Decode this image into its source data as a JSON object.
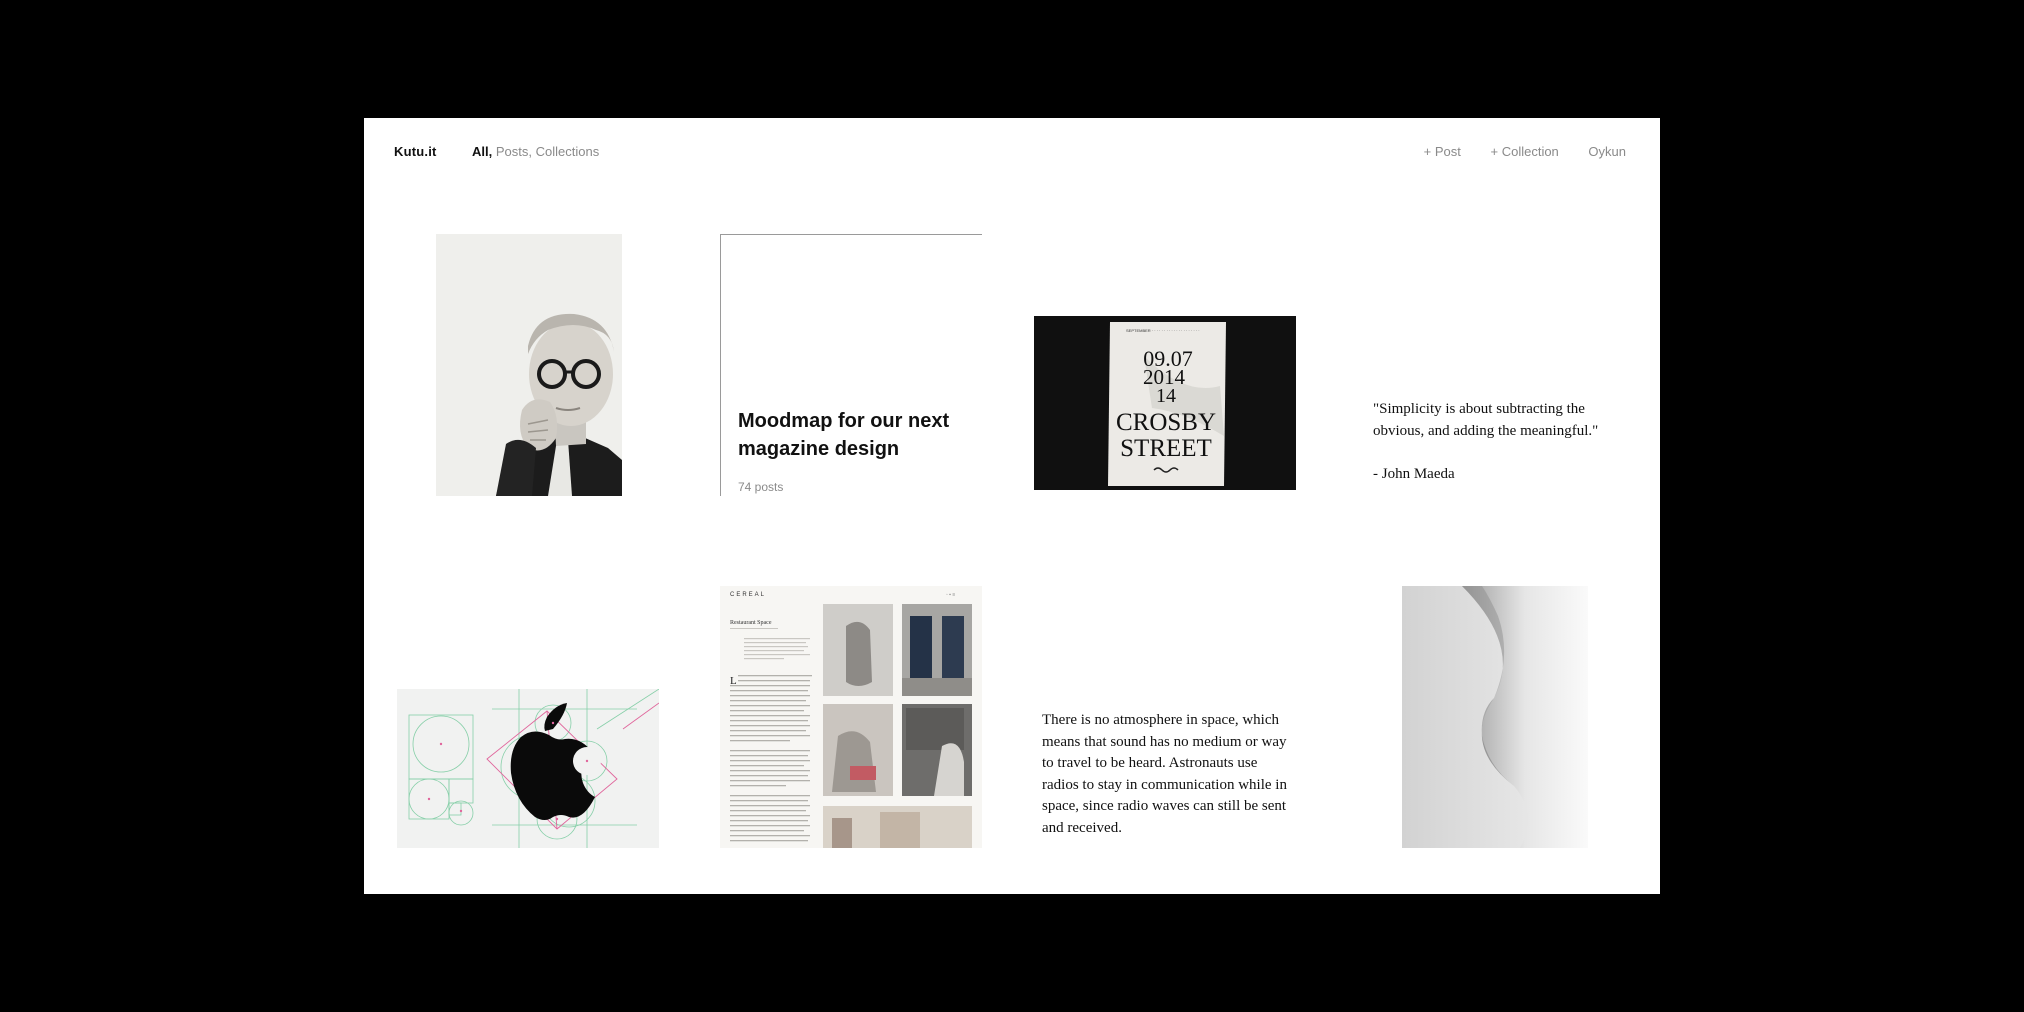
{
  "nav": {
    "brand": "Kutu.it",
    "filters": {
      "all": "All,",
      "posts": "Posts,",
      "collections": "Collections"
    },
    "actions": {
      "add_post": "+ Post",
      "add_collection": "+ Collection",
      "user": "Oykun"
    }
  },
  "cards": {
    "collection": {
      "title": "Moodmap for our next magazine design",
      "count": "74 posts"
    },
    "poster": {
      "date": "09.07",
      "year": "2014",
      "num": "14",
      "street1": "CROSBY",
      "street2": "STREET"
    },
    "quote": {
      "text": "\"Simplicity is about subtracting the obvious, and adding the meaningful.\"",
      "author": "- John Maeda"
    },
    "magazine": {
      "brand": "CEREAL",
      "heading": "Restaurant Space"
    },
    "text_card": {
      "body": "There is no atmosphere in space, which means that sound has no medium or way to travel to be heard. Astronauts use radios to stay in communication while in space, since radio waves can still be sent and received."
    }
  },
  "colors": {
    "background": "#000000",
    "page": "#ffffff",
    "text": "#111111",
    "muted": "#8a8a8a",
    "accent_pink": "#e0669c",
    "accent_green": "#86cfa8"
  }
}
